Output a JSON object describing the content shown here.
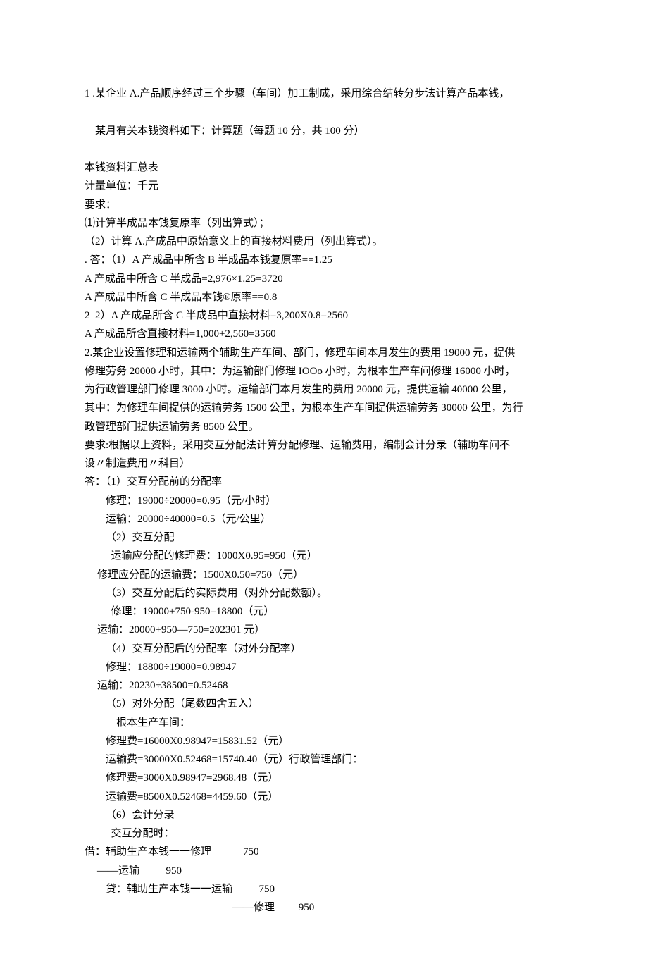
{
  "lines": {
    "l1": "1 .某企业 A.产品顺序经过三个步骤（车间）加工制成，采用综合结转分步法计算产品本钱，",
    "l2a": "某月有关本钱资料如下：",
    "l2b": "计算题（每题 10 分，共 100 分）",
    "l3": "本钱资料汇总表",
    "l4": "计量单位：千元",
    "l5": "要求：",
    "l6": "⑴计算半成品本钱复原率（列出算式）；",
    "l7": "（2）计算 A.产成品中原始意义上的直接材料费用（列出算式）。",
    "l8": ". 答：（1）A 产成品中所含 B 半成品本钱复原率==1.25",
    "l9": "A 产成品中所含 C 半成品=2,976×1.25=3720",
    "l10": "A 产成品中所含 C 半成品本钱®原率==0.8",
    "l11": "2  2）A 产成品所含 C 半成品中直接材料=3,200X0.8=2560",
    "l12": "A 产成品所含直接材料=1,000+2,560=3560",
    "l13": "2.某企业设置修理和运输两个辅助生产车间、部门，修理车间本月发生的费用 19000 元，提供",
    "l14": "修理劳务 20000 小时，其中：为运输部门修理 IOOo 小时，为根本生产车间修理 16000 小时，",
    "l15": "为行政管理部门修理 3000 小时。运输部门本月发生的费用 20000 元，提供运输 40000 公里，",
    "l16": "其中：为修理车间提供的运输劳务 1500 公里，为根本生产车间提供运输劳务 30000 公里，为行",
    "l17": "政管理部门提供运输劳务 8500 公里。",
    "l18": "要求:根据以上资料，采用交互分配法计算分配修理、运输费用，编制会计分录（辅助车间不",
    "l19": "设〃制造费用〃科目）",
    "l20": "答：（1）交互分配前的分配率",
    "l21": "修理：19000÷20000=0.95（元/小时）",
    "l22": "运输：20000÷40000=0.5（元/公里）",
    "l23": "（2）交互分配",
    "l24": "运输应分配的修理费：1000X0.95=950（元）",
    "l25": "修理应分配的运输费：1500X0.50=750（元）",
    "l26": "（3）交互分配后的实际费用（对外分配数额）。",
    "l27": "修理：19000+750-950=18800（元）",
    "l28": "运输：20000+950—750=202301 元）",
    "l29": "（4）交互分配后的分配率（对外分配率）",
    "l30": "修理：18800÷19000=0.98947",
    "l31": "运输：20230÷38500=0.52468",
    "l32": "（5）对外分配（尾数四舍五入）",
    "l33": "根本生产车间：",
    "l34": "修理费=16000X0.98947=15831.52（元）",
    "l35": "运输费=30000X0.52468=15740.40（元）行政管理部门：",
    "l36": "修理费=3000X0.98947=2968.48（元）",
    "l37": "运输费=8500X0.52468=4459.60（元）",
    "l38": "（6）会计分录",
    "l39": "交互分配时：",
    "l40": "借：辅助生产本钱一一修理            750",
    "l41": "――运输          950",
    "l42": "贷：辅助生产本钱一一运输          750",
    "l43": "――修理         950"
  }
}
